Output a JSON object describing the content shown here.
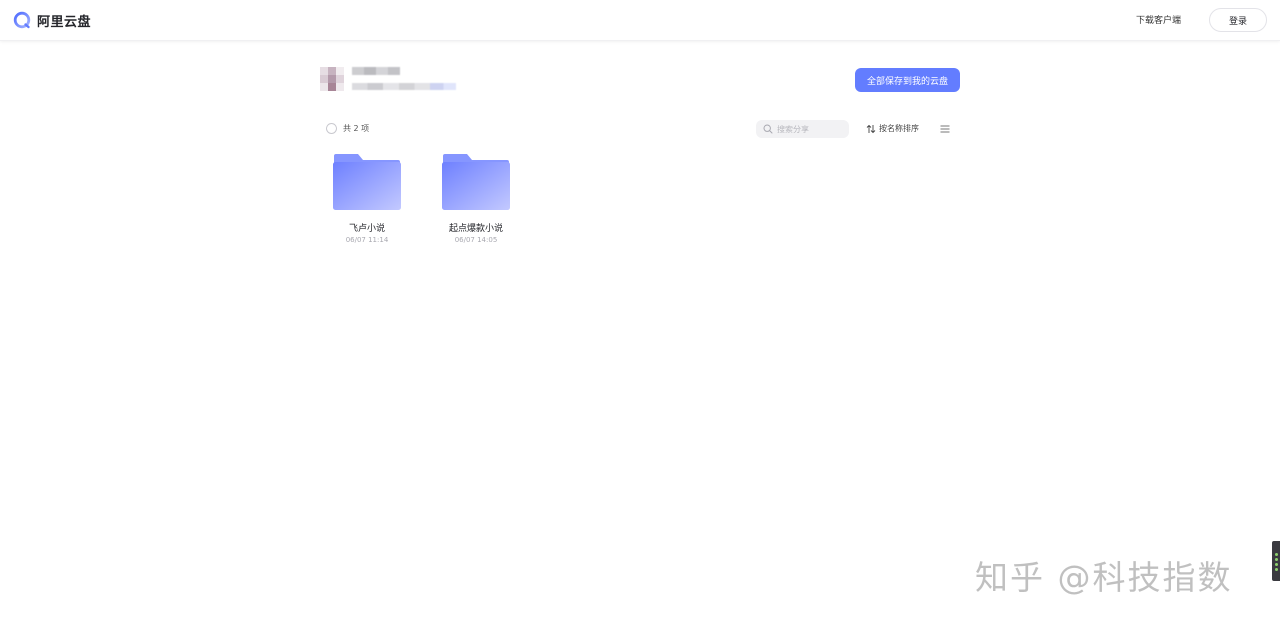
{
  "header": {
    "app_name": "阿里云盘",
    "download_label": "下载客户端",
    "login_label": "登录"
  },
  "share": {
    "save_all_label": "全部保存到我的云盘"
  },
  "toolbar": {
    "count_label": "共 2 项",
    "search_placeholder": "搜索分享",
    "sort_label": "按名称排序"
  },
  "files": [
    {
      "name": "飞卢小说",
      "time": "06/07 11:14"
    },
    {
      "name": "起点爆款小说",
      "time": "06/07 14:05"
    }
  ],
  "watermark": "知乎 @科技指数",
  "colors": {
    "accent": "#637dff",
    "folder_top": "#8a9bff",
    "folder_body": "#6f7fff"
  }
}
